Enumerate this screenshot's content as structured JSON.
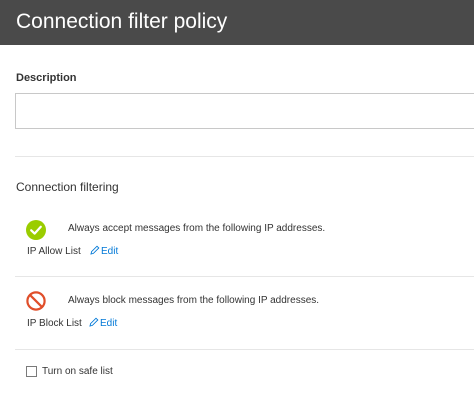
{
  "header": {
    "title": "Connection filter policy"
  },
  "description": {
    "label": "Description",
    "value": "",
    "placeholder": ""
  },
  "connection_filtering": {
    "title": "Connection filtering",
    "allow": {
      "icon": "checkmark-circle-icon",
      "icon_color": "#9acd00",
      "text": "Always accept messages from the following IP addresses.",
      "list_label": "IP Allow List",
      "edit_label": "Edit"
    },
    "block": {
      "icon": "blocked-icon",
      "icon_color": "#e04e2a",
      "text": "Always block messages from the following IP addresses.",
      "list_label": "IP Block List",
      "edit_label": "Edit"
    },
    "safe_list": {
      "label": "Turn on safe list",
      "checked": false
    }
  },
  "colors": {
    "header_bg": "#4a4a4a",
    "link": "#0078d7"
  }
}
